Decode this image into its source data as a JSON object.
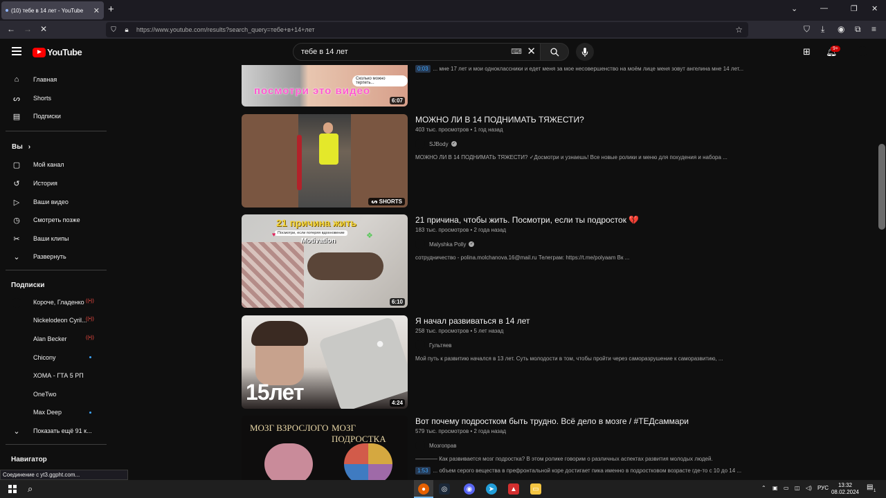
{
  "browser": {
    "tab_title": "(10) тебе в 14 лет - YouTube",
    "tab_close": "✕",
    "new_tab": "+",
    "url": "https://www.youtube.com/results?search_query=тебе+в+14+лет",
    "status_text": "Соединение с yt3.ggpht.com..."
  },
  "header": {
    "logo_text": "YouTube",
    "search_value": "тебе в 14 лет",
    "notif_count": "9+"
  },
  "sidebar": {
    "main": [
      {
        "label": "Главная",
        "icon": "home-icon"
      },
      {
        "label": "Shorts",
        "icon": "shorts-icon"
      },
      {
        "label": "Подписки",
        "icon": "subscriptions-icon"
      }
    ],
    "you_heading": "Вы",
    "you": [
      {
        "label": "Мой канал",
        "icon": "channel-icon"
      },
      {
        "label": "История",
        "icon": "history-icon"
      },
      {
        "label": "Ваши видео",
        "icon": "your-videos-icon"
      },
      {
        "label": "Смотреть позже",
        "icon": "watch-later-icon"
      },
      {
        "label": "Ваши клипы",
        "icon": "clips-icon"
      },
      {
        "label": "Развернуть",
        "icon": "chevron-down-icon"
      }
    ],
    "subs_heading": "Подписки",
    "subs": [
      {
        "label": "Короче, Гладенко",
        "live": true,
        "dot": false
      },
      {
        "label": "Nickelodeon Cyril...",
        "live": true,
        "dot": false
      },
      {
        "label": "Alan Becker",
        "live": true,
        "dot": false
      },
      {
        "label": "Chicony",
        "live": false,
        "dot": true
      },
      {
        "label": "ХОМА - ГТА 5 РП",
        "live": false,
        "dot": false
      },
      {
        "label": "OneTwo",
        "live": false,
        "dot": false
      },
      {
        "label": "Max Deep",
        "live": false,
        "dot": true
      }
    ],
    "show_more": "Показать ещё 91 к...",
    "nav_heading": "Навигатор"
  },
  "results": [
    {
      "title": "",
      "meta": "",
      "channel": "",
      "desc": "... мне 17 лет и мои одноклассники и едет меня за мое несовершенство на моём лице меня зовут ангелина мне 14 лет...",
      "timestamp": "0:03",
      "duration": "6:07",
      "thumb_text": "посмотри это видео",
      "thumb_bubble": "Сколько можно терпеть..."
    },
    {
      "title": "МОЖНО ЛИ В 14 ПОДНИМАТЬ ТЯЖЕСТИ?",
      "meta": "403 тыс. просмотров • 1 год назад",
      "channel": "SJBody",
      "verified": true,
      "desc": "МОЖНО ЛИ В 14 ПОДНИМАТЬ ТЯЖЕСТИ? ✓Досмотри и узнаешь! Все новые ролики и меню для похудения и набора ...",
      "badge": "SHORTS"
    },
    {
      "title": "21 причина, чтобы жить. Посмотри, если ты подросток 💔",
      "meta": "183 тыс. просмотров • 2 года назад",
      "channel": "Malyshka Polly",
      "verified": true,
      "desc": "сотрудничество - polina.molchanova.16@mail.ru Телеграм: https://t.me/polyaam Вк ...",
      "duration": "6:10",
      "thumb_text": "21 причина жить",
      "thumb_sub": "Посмотри, если потеряя вдохновение",
      "thumb_word": "Motivation"
    },
    {
      "title": "Я начал развиваться в 14 лет",
      "meta": "258 тыс. просмотров • 5 лет назад",
      "channel": "Гультяев",
      "verified": false,
      "desc": "Мой путь к развитию начался в 13 лет. Суть молодости в том, чтобы пройти через саморазрушение к саморазвитию, ...",
      "duration": "4:24",
      "thumb_text": "15лет"
    },
    {
      "title": "Вот почему подростком быть трудно. Всё дело в мозге / #ТЕДсаммари",
      "meta": "579 тыс. просмотров • 2 года назад",
      "channel": "Мозгоправ",
      "verified": false,
      "desc": "———— Как развивается мозг подростка? В этом ролике говорим о различных аспектах развития молодых людей.",
      "desc2": "... объем серого вещества в префронтальной коре достигает пика именно в подростковом возрасте где-то с 10 до 14 ...",
      "timestamp": "1:53",
      "thumb_left": "МОЗГ ВЗРОСЛОГО",
      "thumb_right": "МОЗГ ПОДРОСТКА"
    }
  ],
  "taskbar": {
    "lang": "РУС",
    "time": "13:32",
    "date": "08.02.2024",
    "notif": "1"
  }
}
